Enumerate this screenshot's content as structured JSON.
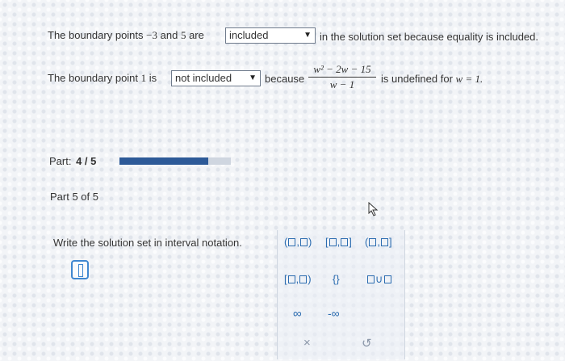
{
  "line1": {
    "prefix": "The boundary points",
    "point_a": "−3",
    "and": "and",
    "point_b": "5",
    "are": "are",
    "select_value": "included",
    "suffix": "in the solution set because equality is included."
  },
  "line2": {
    "prefix": "The boundary point",
    "point": "1",
    "is": "is",
    "select_value": "not included",
    "because": "because",
    "numerator": "w² − 2w − 15",
    "denominator": "w − 1",
    "suffix_text": "is undefined for",
    "condition": "w = 1."
  },
  "part_progress": {
    "label": "Part:",
    "value": "4 / 5",
    "fraction": 0.8
  },
  "part_header": "Part 5 of 5",
  "instruction": "Write the solution set in interval notation.",
  "palette": {
    "row1": [
      "(□,□)",
      "[□,□]",
      "(□,□]"
    ],
    "row2": [
      "[□,□)",
      "{}",
      "□∪□"
    ],
    "row3": [
      "∞",
      "-∞"
    ],
    "clear_icon": "×",
    "undo_icon": "↺"
  },
  "colors": {
    "accent": "#2b6cb0",
    "progress": "#2d5a98"
  }
}
